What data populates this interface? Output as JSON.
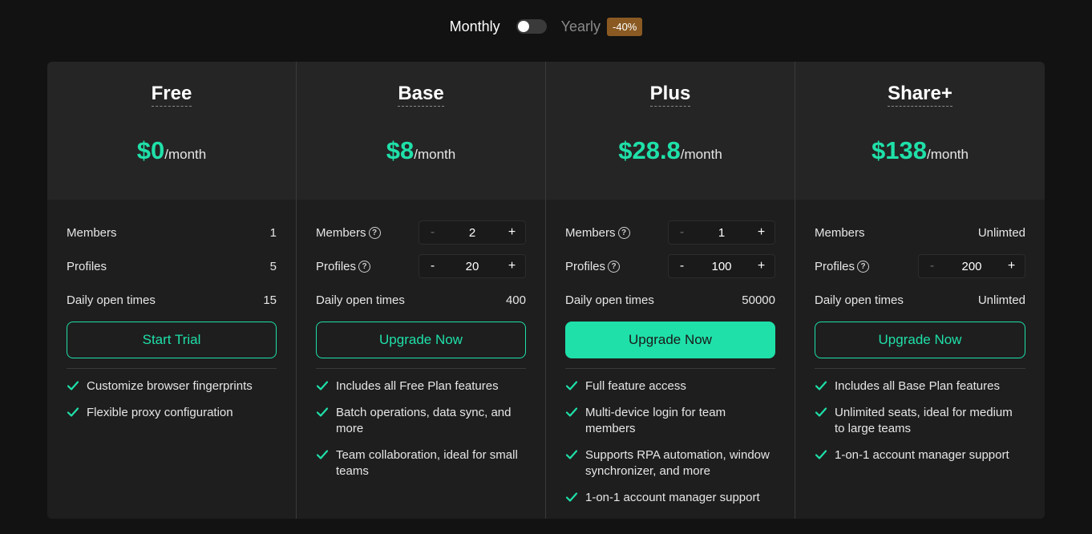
{
  "billing": {
    "monthly_label": "Monthly",
    "yearly_label": "Yearly",
    "discount_badge": "-40%",
    "toggle_state": "monthly"
  },
  "colors": {
    "accent": "#1fe0a9",
    "badge": "#8a5a22",
    "panel": "#1e1e1e",
    "header": "#252525"
  },
  "plans": [
    {
      "name": "Free",
      "price": "$0",
      "period": "/month",
      "members_label": "Members",
      "members_value": "1",
      "profiles_label": "Profiles",
      "profiles_value": "5",
      "daily_label": "Daily open times",
      "daily_value": "15",
      "cta": "Start Trial",
      "features": [
        "Customize browser fingerprints",
        "Flexible proxy configuration"
      ]
    },
    {
      "name": "Base",
      "price": "$8",
      "period": "/month",
      "members_label": "Members",
      "members_value": "2",
      "profiles_label": "Profiles",
      "profiles_value": "20",
      "daily_label": "Daily open times",
      "daily_value": "400",
      "cta": "Upgrade Now",
      "features": [
        "Includes all Free Plan features",
        "Batch operations, data sync, and more",
        "Team collaboration, ideal for small teams"
      ]
    },
    {
      "name": "Plus",
      "price": "$28.8",
      "period": "/month",
      "members_label": "Members",
      "members_value": "1",
      "profiles_label": "Profiles",
      "profiles_value": "100",
      "daily_label": "Daily open times",
      "daily_value": "50000",
      "cta": "Upgrade Now",
      "features": [
        "Full feature access",
        "Multi-device login for team members",
        "Supports RPA automation, window synchronizer, and more",
        "1-on-1 account manager support"
      ]
    },
    {
      "name": "Share+",
      "price": "$138",
      "period": "/month",
      "members_label": "Members",
      "members_value": "Unlimted",
      "profiles_label": "Profiles",
      "profiles_value": "200",
      "daily_label": "Daily open times",
      "daily_value": "Unlimted",
      "cta": "Upgrade Now",
      "features": [
        "Includes all Base Plan features",
        "Unlimited seats, ideal for medium to large teams",
        "1-on-1 account manager support"
      ]
    }
  ],
  "stepper": {
    "minus": "-",
    "plus": "+"
  },
  "help_icon": "?"
}
